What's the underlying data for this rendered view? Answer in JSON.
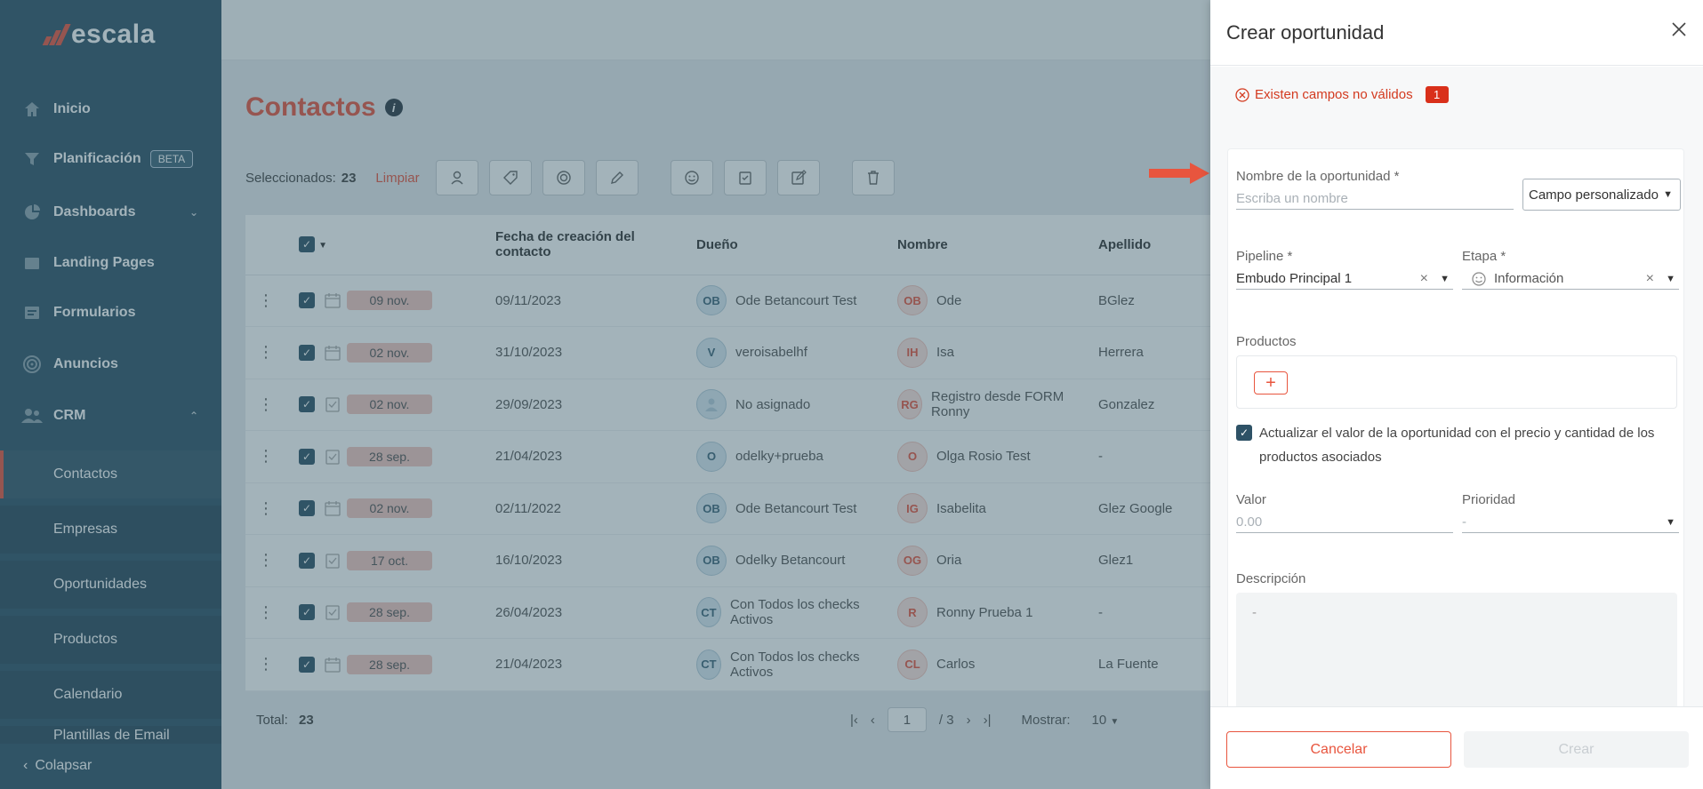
{
  "brand": {
    "name": "escala"
  },
  "sidebar": {
    "items": [
      {
        "label": "Inicio"
      },
      {
        "label": "Planificación",
        "badge": "BETA"
      },
      {
        "label": "Dashboards"
      },
      {
        "label": "Landing Pages"
      },
      {
        "label": "Formularios"
      },
      {
        "label": "Anuncios"
      },
      {
        "label": "CRM"
      }
    ],
    "crm_sub": [
      {
        "label": "Contactos"
      },
      {
        "label": "Empresas"
      },
      {
        "label": "Oportunidades"
      },
      {
        "label": "Productos"
      },
      {
        "label": "Calendario"
      },
      {
        "label": "Plantillas de Email"
      }
    ],
    "collapse_label": "Colapsar"
  },
  "page": {
    "title": "Contactos"
  },
  "selection": {
    "label": "Seleccionados:",
    "count": "23",
    "clear": "Limpiar"
  },
  "table": {
    "headers": {
      "created": "Fecha de creación del contacto",
      "owner": "Dueño",
      "name": "Nombre",
      "lastname": "Apellido"
    },
    "rows": [
      {
        "pill": "09 nov.",
        "created": "09/11/2023",
        "owner_init": "OB",
        "owner": "Ode Betancourt Test",
        "name_init": "OB",
        "name": "Ode",
        "lastname": "BGlez"
      },
      {
        "pill": "02 nov.",
        "created": "31/10/2023",
        "owner_init": "V",
        "owner": "veroisabelhf",
        "name_init": "IH",
        "name": "Isa",
        "lastname": "Herrera"
      },
      {
        "pill": "02 nov.",
        "created": "29/09/2023",
        "owner_init": "",
        "owner": "No asignado",
        "name_init": "RG",
        "name": "Registro desde FORM Ronny",
        "lastname": "Gonzalez"
      },
      {
        "pill": "28 sep.",
        "created": "21/04/2023",
        "owner_init": "O",
        "owner": "odelky+prueba",
        "name_init": "O",
        "name": "Olga Rosio Test",
        "lastname": "-"
      },
      {
        "pill": "02 nov.",
        "created": "02/11/2022",
        "owner_init": "OB",
        "owner": "Ode Betancourt Test",
        "name_init": "IG",
        "name": "Isabelita",
        "lastname": "Glez Google"
      },
      {
        "pill": "17 oct.",
        "created": "16/10/2023",
        "owner_init": "OB",
        "owner": "Odelky Betancourt",
        "name_init": "OG",
        "name": "Oria",
        "lastname": "Glez1"
      },
      {
        "pill": "28 sep.",
        "created": "26/04/2023",
        "owner_init": "CT",
        "owner": "Con Todos los checks Activos",
        "name_init": "R",
        "name": "Ronny Prueba 1",
        "lastname": "-"
      },
      {
        "pill": "28 sep.",
        "created": "21/04/2023",
        "owner_init": "CT",
        "owner": "Con Todos los checks Activos",
        "name_init": "CL",
        "name": "Carlos",
        "lastname": "La Fuente"
      }
    ]
  },
  "footer": {
    "total_label": "Total:",
    "total": "23",
    "page": "1",
    "pages": "/ 3",
    "show_label": "Mostrar:",
    "show_value": "10"
  },
  "drawer": {
    "title": "Crear oportunidad",
    "error_text": "Existen campos no válidos",
    "error_count": "1",
    "name_label": "Nombre de la oportunidad *",
    "name_placeholder": "Escriba un nombre",
    "custom_field": "Campo personalizado",
    "pipeline_label": "Pipeline *",
    "pipeline_value": "Embudo Principal 1",
    "stage_label": "Etapa *",
    "stage_value": "Información",
    "products_label": "Productos",
    "update_label": "Actualizar el valor de la oportunidad con el precio y cantidad de los productos asociados",
    "value_label": "Valor",
    "value_placeholder": "0.00",
    "priority_label": "Prioridad",
    "priority_value": "-",
    "desc_label": "Descripción",
    "desc_placeholder": "-",
    "cancel": "Cancelar",
    "create": "Crear"
  },
  "colors": {
    "accent": "#e8553e",
    "sidebar": "#2e5266",
    "error": "#d9301a"
  }
}
